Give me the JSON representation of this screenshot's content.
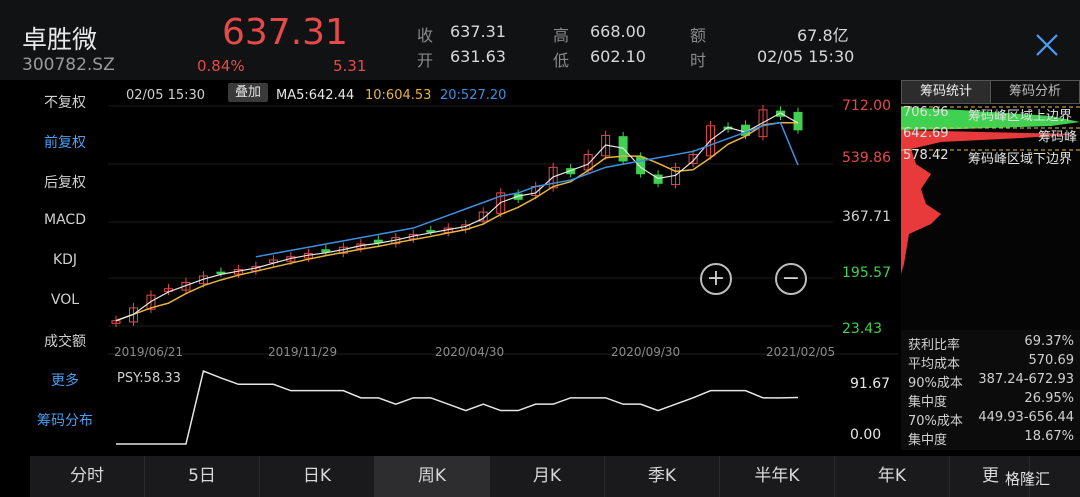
{
  "stock": {
    "name": "卓胜微",
    "code": "300782.SZ",
    "price": "637.31",
    "change_pct": "0.84%",
    "change": "5.31"
  },
  "quote": {
    "close_label": "收",
    "close_value": "637.31",
    "open_label": "开",
    "open_value": "631.63",
    "high_label": "高",
    "high_value": "668.00",
    "low_label": "低",
    "low_value": "602.10",
    "amount_label": "额",
    "amount_value": "67.8亿",
    "time_label": "时",
    "time_value": "02/05 15:30"
  },
  "menu": {
    "items": [
      {
        "label": "不复权"
      },
      {
        "label": "前复权"
      },
      {
        "label": "后复权"
      },
      {
        "label": "MACD"
      },
      {
        "label": "KDJ"
      },
      {
        "label": "VOL"
      },
      {
        "label": "成交额"
      },
      {
        "label": "更多"
      },
      {
        "label": "筹码分布"
      }
    ]
  },
  "legend": {
    "time": "02/05 15:30",
    "overlay": "叠加",
    "ma5": "MA5:642.44",
    "ma10": "10:604.53",
    "ma20": "20:527.20"
  },
  "colors": {
    "up": "#e84a4a",
    "down": "#3fd14f",
    "ma5": "#e6e6e6",
    "ma10": "#e6b43c",
    "ma20": "#3e8fe0",
    "accent": "#4a9df0"
  },
  "price_axis": {
    "labels": [
      "712.00",
      "539.86",
      "367.71",
      "195.57",
      "23.43"
    ]
  },
  "dates": [
    "2019/06/21",
    "2019/11/29",
    "2020/04/30",
    "2020/09/30",
    "2021/02/05"
  ],
  "psy": {
    "label": "PSY:58.33",
    "axis": [
      "91.67",
      "0.00"
    ]
  },
  "zoom": {
    "in": "+",
    "out": "−"
  },
  "chips": {
    "tabs": [
      "筹码统计",
      "筹码分析"
    ],
    "upper_price": "706.96",
    "upper_label": "筹码峰区域上边界",
    "peak_price": "642.69",
    "peak_label": "筹码峰",
    "lower_price": "578.42",
    "lower_label": "筹码峰区域下边界",
    "stats": [
      {
        "label": "获利比率",
        "value": "69.37%"
      },
      {
        "label": "平均成本",
        "value": "570.69"
      },
      {
        "label": "90%成本",
        "value": "387.24-672.93"
      },
      {
        "label": "集中度",
        "value": "26.95%"
      },
      {
        "label": "70%成本",
        "value": "449.93-656.44"
      },
      {
        "label": "集中度",
        "value": "18.67%"
      }
    ]
  },
  "tabs": [
    "分时",
    "5日",
    "日K",
    "周K",
    "月K",
    "季K",
    "半年K",
    "年K",
    "更"
  ],
  "watermark": "格隆汇",
  "chart_data": {
    "type": "candlestick",
    "x_dates": [
      "2019/06/21",
      "2019/11/29",
      "2020/04/30",
      "2020/09/30",
      "2021/02/05"
    ],
    "ylim": [
      23.43,
      712.0
    ],
    "close_approx": [
      40,
      80,
      120,
      140,
      160,
      180,
      190,
      200,
      210,
      230,
      240,
      250,
      255,
      270,
      280,
      285,
      300,
      310,
      320,
      330,
      340,
      380,
      440,
      420,
      460,
      520,
      500,
      560,
      620,
      540,
      500,
      470,
      520,
      560,
      650,
      640,
      620,
      700,
      680,
      637.31
    ],
    "ma20_approx": [
      120,
      130,
      150,
      170,
      190,
      200,
      210,
      230,
      240,
      250,
      260,
      270,
      280,
      290,
      300,
      310,
      320,
      330,
      350,
      370,
      390,
      410,
      430,
      440,
      460,
      470,
      480,
      500,
      520,
      530,
      540,
      550,
      560,
      570,
      590,
      610,
      630,
      650,
      660,
      527.2
    ],
    "psy_approx": [
      0,
      0,
      0,
      0,
      0,
      91.67,
      83,
      75,
      75,
      75,
      67,
      67,
      67,
      67,
      58,
      58,
      50,
      58,
      58,
      50,
      42,
      50,
      42,
      42,
      50,
      50,
      58,
      58,
      58,
      50,
      50,
      42,
      50,
      58,
      67,
      67,
      67,
      58,
      58,
      58.33
    ]
  }
}
